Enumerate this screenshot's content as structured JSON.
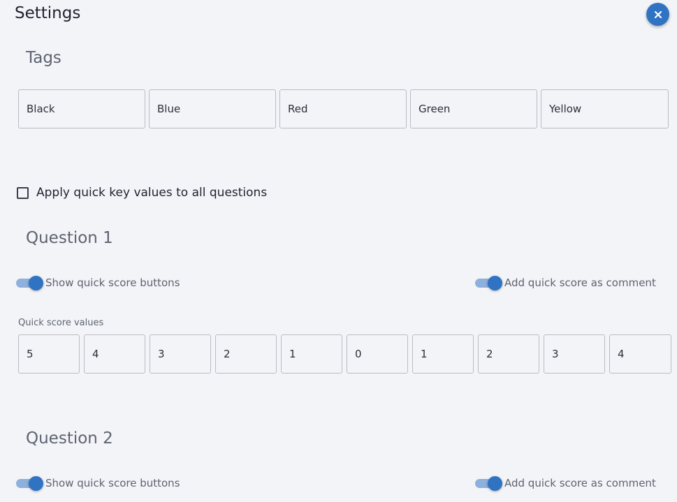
{
  "header": {
    "title": "Settings",
    "close_icon": "close-icon"
  },
  "tags": {
    "heading": "Tags",
    "values": [
      "Black",
      "Blue",
      "Red",
      "Green",
      "Yellow"
    ]
  },
  "apply_all": {
    "label": "Apply quick key values to all questions",
    "checked": false
  },
  "questions": [
    {
      "heading": "Question 1",
      "show_buttons_label": "Show quick score buttons",
      "show_buttons_on": true,
      "add_comment_label": "Add quick score as comment",
      "add_comment_on": true,
      "score_values_label": "Quick score values",
      "score_values": [
        "5",
        "4",
        "3",
        "2",
        "1",
        "0",
        "1",
        "2",
        "3",
        "4"
      ]
    },
    {
      "heading": "Question 2",
      "show_buttons_label": "Show quick score buttons",
      "show_buttons_on": true,
      "add_comment_label": "Add quick score as comment",
      "add_comment_on": true
    }
  ],
  "colors": {
    "accent": "#3073c2",
    "track": "#8db0dd",
    "background": "#f3f4f8"
  }
}
